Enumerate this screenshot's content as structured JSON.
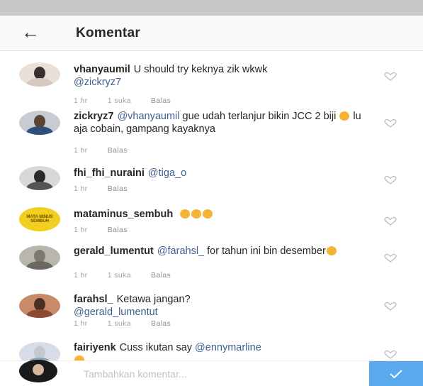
{
  "header": {
    "back_icon": "arrow-left-icon",
    "title": "Komentar"
  },
  "comments": [
    {
      "username": "vhanyaumil",
      "pre": "U should try keknya zik wkwk",
      "mention": "@zickryz7",
      "post": "",
      "time": "1 hr",
      "likes": "1 suka",
      "reply": "Balas",
      "avatar_color": "#d9c8bd"
    },
    {
      "username": "zickryz7",
      "mention": "@vhanyaumil",
      "pre": "",
      "post": "gue udah terlanjur bikin JCC 2 biji",
      "post2": "lu aja cobain, gampang kayaknya",
      "time": "1 hr",
      "likes": "",
      "reply": "Balas",
      "avatar_color": "#8fa2b6"
    },
    {
      "username": "fhi_fhi_nuraini",
      "mention": "@tiga_o",
      "pre": "",
      "post": "",
      "time": "1 hr",
      "likes": "",
      "reply": "Balas",
      "avatar_color": "#7d7d7d"
    },
    {
      "username": "mataminus_sembuh",
      "mention": "",
      "pre": "",
      "post": "",
      "time": "1 hr",
      "likes": "",
      "reply": "Balas",
      "avatar_color": "#f2cf1e",
      "badge_text": "MATA MINUS SEMBUH"
    },
    {
      "username": "gerald_lumentut",
      "mention": "@farahsl_",
      "pre": "",
      "post": "for tahun ini bin desember",
      "time": "1 hr",
      "likes": "1 suka",
      "reply": "Balas",
      "avatar_color": "#a9a9a1"
    },
    {
      "username": "farahsl_",
      "pre": "Ketawa jangan?",
      "mention": "@gerald_lumentut",
      "post": "",
      "time": "1 hr",
      "likes": "1 suka",
      "reply": "Balas",
      "avatar_color": "#b46a4c"
    },
    {
      "username": "fairiyenk",
      "pre": "Cuss ikutan say",
      "mention": "@ennymarline",
      "post": "",
      "time": "",
      "likes": "",
      "reply": "",
      "avatar_color": "#9fb0c2"
    }
  ],
  "composer": {
    "placeholder": "Tambahkan komentar...",
    "send_icon": "checkmark-icon",
    "send_color": "#5aa9ec"
  },
  "colors": {
    "mention": "#3f5f8f",
    "meta": "#a0a0a0"
  }
}
